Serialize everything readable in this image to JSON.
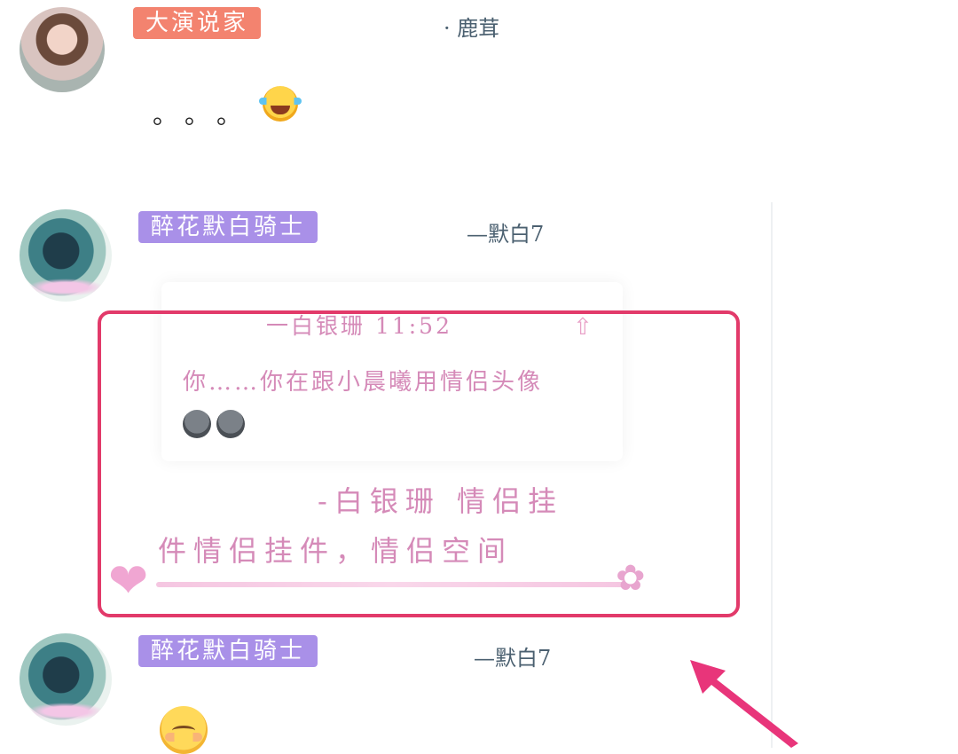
{
  "messages": [
    {
      "tag": "大演说家",
      "username": "· 鹿茸",
      "text": "。。。",
      "emoji": "laughing-tears-emoji"
    },
    {
      "tag": "醉花默白骑士",
      "username": "—默白7",
      "quote": {
        "header": "一白银珊 11:52",
        "text": "你……你在跟小晨曦用情侣头像"
      },
      "reply_line1": "-白银珊 情侣挂",
      "reply_line2": "件情侣挂件，情侣空间"
    },
    {
      "tag": "醉花默白骑士",
      "username": "—默白7",
      "emoji": "smiling-blush-emoji"
    }
  ],
  "colors": {
    "tag_orange": "#f3836f",
    "tag_purple": "#a990e8",
    "highlight": "#e23a6a",
    "pink_text": "#d58ab8"
  }
}
